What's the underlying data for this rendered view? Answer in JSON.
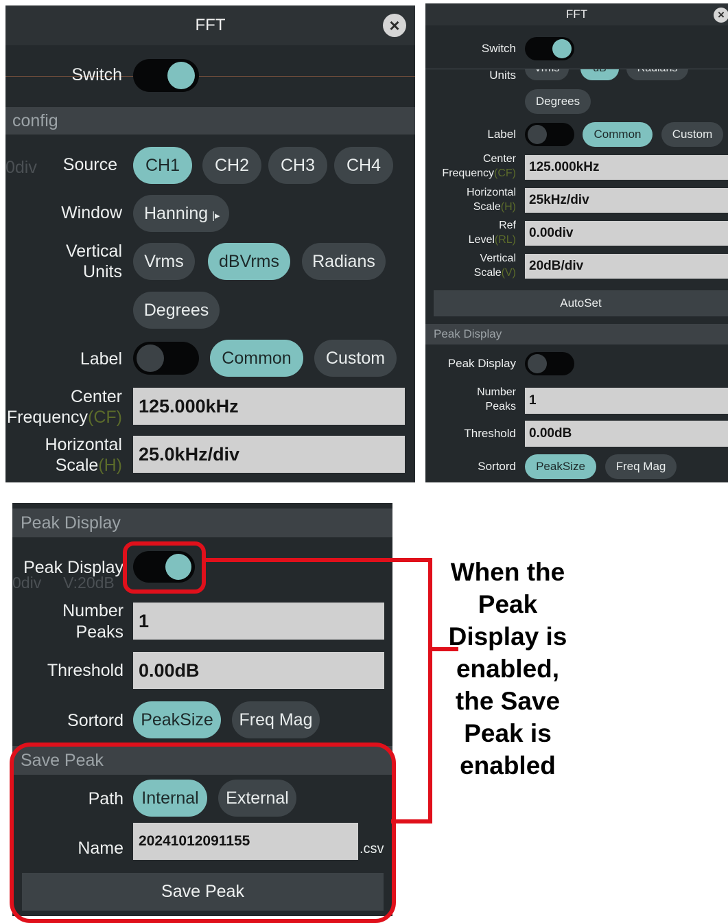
{
  "panel_a": {
    "title": "FFT",
    "close_glyph": "×",
    "switch_label": "Switch",
    "section": "config",
    "bg_faint": "0div",
    "source_label": "Source",
    "sources": [
      "CH1",
      "CH2",
      "CH3",
      "CH4"
    ],
    "window_label": "Window",
    "window_value": "Hanning",
    "units_label_1": "Vertical",
    "units_label_2": "Units",
    "units": [
      "Vrms",
      "dBVrms",
      "Radians",
      "Degrees"
    ],
    "label_label": "Label",
    "label_opts": [
      "Common",
      "Custom"
    ],
    "cf_label_1": "Center",
    "cf_label_2": "Frequency",
    "cf_suffix": "(CF)",
    "cf_value": "125.000kHz",
    "hs_label_1": "Horizontal",
    "hs_label_2": "Scale",
    "hs_suffix": "(H)",
    "hs_value": "25.0kHz/div"
  },
  "panel_b": {
    "title": "FFT",
    "close_glyph": "×",
    "switch_label": "Switch",
    "units_label": "Units",
    "units_cut": [
      "Vrms",
      "dB",
      "Radians"
    ],
    "degrees": "Degrees",
    "label_label": "Label",
    "label_opts": [
      "Common",
      "Custom"
    ],
    "cf_label_1": "Center",
    "cf_label_2": "Frequency",
    "cf_suffix": "(CF)",
    "cf_value": "125.000kHz",
    "hs_label_1": "Horizontal",
    "hs_label_2": "Scale",
    "hs_suffix": "(H)",
    "hs_value": "25kHz/div",
    "rl_label_1": "Ref",
    "rl_label_2": "Level",
    "rl_suffix": "(RL)",
    "rl_value": "0.00div",
    "vs_label_1": "Vertical",
    "vs_label_2": "Scale",
    "vs_suffix": "(V)",
    "vs_value": "20dB/div",
    "autoset": "AutoSet",
    "peak_section": "Peak Display",
    "peak_display_label": "Peak Display",
    "np_label_1": "Number",
    "np_label_2": "Peaks",
    "np_value": "1",
    "threshold_label": "Threshold",
    "threshold_value": "0.00dB",
    "sortord_label": "Sortord",
    "sort_opts": [
      "PeakSize",
      "Freq Mag"
    ]
  },
  "panel_c": {
    "peak_section": "Peak Display",
    "peak_display_label": "Peak Display",
    "bg_faint": "0div     V:20dB",
    "np_label_1": "Number",
    "np_label_2": "Peaks",
    "np_value": "1",
    "threshold_label": "Threshold",
    "threshold_value": "0.00dB",
    "sortord_label": "Sortord",
    "sort_opts": [
      "PeakSize",
      "Freq Mag"
    ],
    "save_section": "Save Peak",
    "path_label": "Path",
    "path_opts": [
      "Internal",
      "External"
    ],
    "name_label": "Name",
    "name_value": "20241012091155",
    "name_ext": ".csv",
    "save_button": "Save Peak"
  },
  "annotation": {
    "text": "When the\nPeak\nDisplay  is\nenabled,\nthe Save\nPeak is\nenabled"
  },
  "colors": {
    "panel_bg": "#24292c",
    "accent": "#7fc1bf",
    "highlight": "#e0101b"
  }
}
